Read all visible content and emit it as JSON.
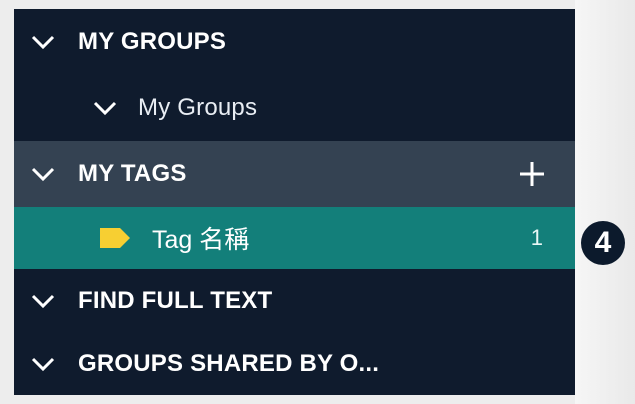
{
  "sidebar": {
    "my_groups": {
      "label": "MY GROUPS",
      "icon": "chevron-down-icon"
    },
    "my_groups_sub": {
      "label": "My Groups",
      "icon": "chevron-down-icon"
    },
    "my_tags": {
      "label": "MY TAGS",
      "icon": "chevron-down-icon",
      "add_icon": "plus-icon"
    },
    "tag_item": {
      "label": "Tag 名稱",
      "count": "1",
      "icon": "tag-icon",
      "icon_color": "#f7cf32"
    },
    "find_full_text": {
      "label": "FIND FULL TEXT",
      "icon": "chevron-down-icon"
    },
    "groups_shared": {
      "label": "GROUPS SHARED BY O...",
      "icon": "chevron-down-icon"
    }
  },
  "callout": {
    "number": "4"
  },
  "colors": {
    "sidebar_bg": "#0f1b2d",
    "section_header_bg": "#344252",
    "selected_bg": "#137f7a",
    "text": "#ffffff"
  }
}
